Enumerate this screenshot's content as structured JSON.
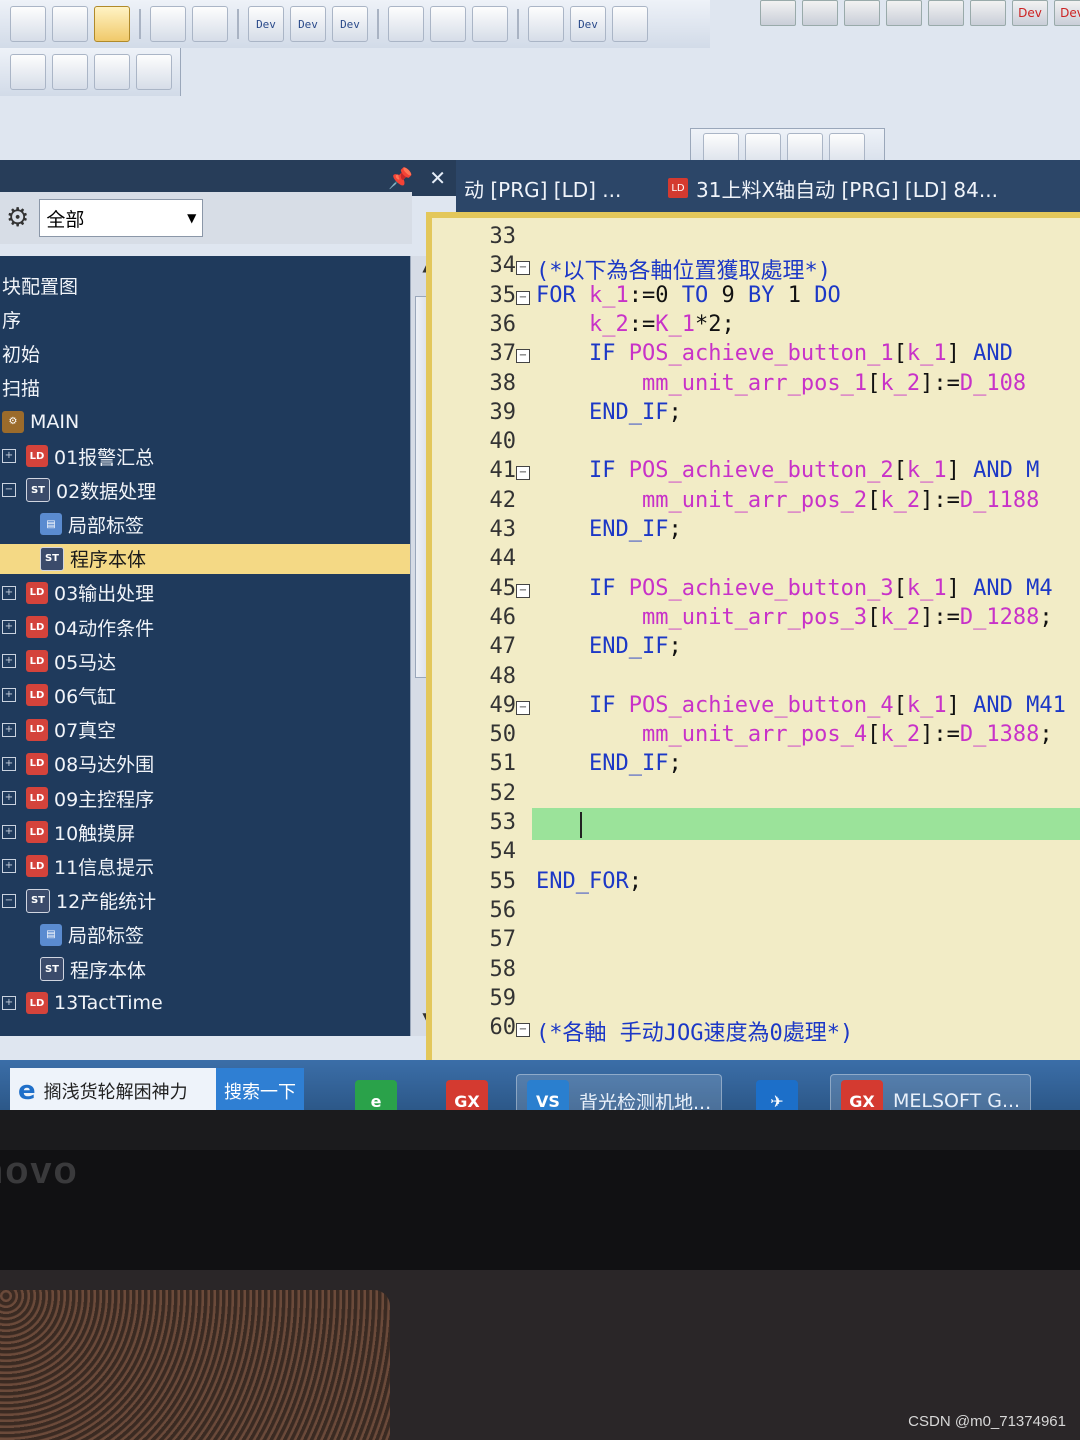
{
  "toolbar": {
    "row1_buttons": [
      "",
      "",
      "",
      "",
      "",
      "Dev",
      "Dev",
      "Dev",
      "",
      "",
      "",
      "",
      "Dev",
      ""
    ],
    "row2_buttons": [
      "",
      "",
      "",
      ""
    ],
    "mini_buttons": [
      "",
      "",
      "",
      ""
    ],
    "top_right": [
      "",
      "",
      "",
      "",
      "",
      "",
      "Dev",
      "Dev"
    ]
  },
  "left_panel": {
    "header_pin": "📌",
    "header_close": "✕",
    "filter_value": "全部",
    "items": [
      {
        "label": "块配置图",
        "icon": "",
        "indent": 0,
        "exp": ""
      },
      {
        "label": "序",
        "icon": "",
        "indent": 0,
        "exp": ""
      },
      {
        "label": "初始",
        "icon": "",
        "indent": 0,
        "exp": ""
      },
      {
        "label": "扫描",
        "icon": "",
        "indent": 0,
        "exp": ""
      },
      {
        "label": "MAIN",
        "icon": "pu",
        "indent": 0,
        "exp": ""
      },
      {
        "label": "01报警汇总",
        "icon": "ld",
        "indent": 1,
        "exp": "+"
      },
      {
        "label": "02数据处理",
        "icon": "st",
        "indent": 1,
        "exp": "−"
      },
      {
        "label": "局部标签",
        "icon": "lbl",
        "indent": 2,
        "exp": ""
      },
      {
        "label": "程序本体",
        "icon": "st",
        "indent": 2,
        "exp": "",
        "selected": true
      },
      {
        "label": "03输出处理",
        "icon": "ld",
        "indent": 1,
        "exp": "+"
      },
      {
        "label": "04动作条件",
        "icon": "ld",
        "indent": 1,
        "exp": "+"
      },
      {
        "label": "05马达",
        "icon": "ld",
        "indent": 1,
        "exp": "+"
      },
      {
        "label": "06气缸",
        "icon": "ld",
        "indent": 1,
        "exp": "+"
      },
      {
        "label": "07真空",
        "icon": "ld",
        "indent": 1,
        "exp": "+"
      },
      {
        "label": "08马达外围",
        "icon": "ld",
        "indent": 1,
        "exp": "+"
      },
      {
        "label": "09主控程序",
        "icon": "ld",
        "indent": 1,
        "exp": "+"
      },
      {
        "label": "10触摸屏",
        "icon": "ld",
        "indent": 1,
        "exp": "+"
      },
      {
        "label": "11信息提示",
        "icon": "ld",
        "indent": 1,
        "exp": "+"
      },
      {
        "label": "12产能统计",
        "icon": "st",
        "indent": 1,
        "exp": "−"
      },
      {
        "label": "局部标签",
        "icon": "lbl",
        "indent": 2,
        "exp": ""
      },
      {
        "label": "程序本体",
        "icon": "st",
        "indent": 2,
        "exp": ""
      },
      {
        "label": "13TactTime",
        "icon": "ld",
        "indent": 1,
        "exp": "+"
      }
    ]
  },
  "tabs": [
    {
      "label": "动 [PRG] [LD] ...",
      "active": false
    },
    {
      "label": "31上料X轴自动 [PRG] [LD] 84...",
      "active": true
    }
  ],
  "editor": {
    "lines": [
      {
        "no": "33",
        "parts": []
      },
      {
        "no": "34",
        "fold": "−",
        "parts": [
          {
            "c": "cm",
            "t": "(*以下為各軸位置獲取處理*)"
          }
        ]
      },
      {
        "no": "35",
        "fold": "−",
        "parts": [
          {
            "c": "kw",
            "t": "FOR "
          },
          {
            "c": "var",
            "t": "k_1"
          },
          {
            "c": "nm",
            "t": ":=0 "
          },
          {
            "c": "kw",
            "t": "TO"
          },
          {
            "c": "nm",
            "t": " 9 "
          },
          {
            "c": "kw",
            "t": "BY"
          },
          {
            "c": "nm",
            "t": " 1 "
          },
          {
            "c": "kw",
            "t": "DO"
          }
        ]
      },
      {
        "no": "36",
        "parts": [
          {
            "c": "nm",
            "t": "    "
          },
          {
            "c": "var",
            "t": "k_2"
          },
          {
            "c": "nm",
            "t": ":="
          },
          {
            "c": "var",
            "t": "K_1"
          },
          {
            "c": "nm",
            "t": "*2;"
          }
        ]
      },
      {
        "no": "37",
        "fold": "−",
        "parts": [
          {
            "c": "nm",
            "t": "    "
          },
          {
            "c": "kw",
            "t": "IF "
          },
          {
            "c": "var",
            "t": "POS_achieve_button_1"
          },
          {
            "c": "nm",
            "t": "["
          },
          {
            "c": "var",
            "t": "k_1"
          },
          {
            "c": "nm",
            "t": "] "
          },
          {
            "c": "kw",
            "t": "AND"
          }
        ]
      },
      {
        "no": "38",
        "parts": [
          {
            "c": "nm",
            "t": "        "
          },
          {
            "c": "var",
            "t": "mm_unit_arr_pos_1"
          },
          {
            "c": "nm",
            "t": "["
          },
          {
            "c": "var",
            "t": "k_2"
          },
          {
            "c": "nm",
            "t": "]:="
          },
          {
            "c": "var",
            "t": "D_108"
          }
        ]
      },
      {
        "no": "39",
        "parts": [
          {
            "c": "nm",
            "t": "    "
          },
          {
            "c": "kw",
            "t": "END_IF"
          },
          {
            "c": "nm",
            "t": ";"
          }
        ]
      },
      {
        "no": "40",
        "parts": []
      },
      {
        "no": "41",
        "fold": "−",
        "parts": [
          {
            "c": "nm",
            "t": "    "
          },
          {
            "c": "kw",
            "t": "IF "
          },
          {
            "c": "var",
            "t": "POS_achieve_button_2"
          },
          {
            "c": "nm",
            "t": "["
          },
          {
            "c": "var",
            "t": "k_1"
          },
          {
            "c": "nm",
            "t": "] "
          },
          {
            "c": "kw",
            "t": "AND M"
          }
        ]
      },
      {
        "no": "42",
        "parts": [
          {
            "c": "nm",
            "t": "        "
          },
          {
            "c": "var",
            "t": "mm_unit_arr_pos_2"
          },
          {
            "c": "nm",
            "t": "["
          },
          {
            "c": "var",
            "t": "k_2"
          },
          {
            "c": "nm",
            "t": "]:="
          },
          {
            "c": "var",
            "t": "D_1188"
          }
        ]
      },
      {
        "no": "43",
        "parts": [
          {
            "c": "nm",
            "t": "    "
          },
          {
            "c": "kw",
            "t": "END_IF"
          },
          {
            "c": "nm",
            "t": ";"
          }
        ]
      },
      {
        "no": "44",
        "parts": []
      },
      {
        "no": "45",
        "fold": "−",
        "parts": [
          {
            "c": "nm",
            "t": "    "
          },
          {
            "c": "kw",
            "t": "IF "
          },
          {
            "c": "var",
            "t": "POS_achieve_button_3"
          },
          {
            "c": "nm",
            "t": "["
          },
          {
            "c": "var",
            "t": "k_1"
          },
          {
            "c": "nm",
            "t": "] "
          },
          {
            "c": "kw",
            "t": "AND M4"
          }
        ]
      },
      {
        "no": "46",
        "parts": [
          {
            "c": "nm",
            "t": "        "
          },
          {
            "c": "var",
            "t": "mm_unit_arr_pos_3"
          },
          {
            "c": "nm",
            "t": "["
          },
          {
            "c": "var",
            "t": "k_2"
          },
          {
            "c": "nm",
            "t": "]:="
          },
          {
            "c": "var",
            "t": "D_1288"
          },
          {
            "c": "nm",
            "t": ";"
          }
        ]
      },
      {
        "no": "47",
        "parts": [
          {
            "c": "nm",
            "t": "    "
          },
          {
            "c": "kw",
            "t": "END_IF"
          },
          {
            "c": "nm",
            "t": ";"
          }
        ]
      },
      {
        "no": "48",
        "parts": []
      },
      {
        "no": "49",
        "fold": "−",
        "parts": [
          {
            "c": "nm",
            "t": "    "
          },
          {
            "c": "kw",
            "t": "IF "
          },
          {
            "c": "var",
            "t": "POS_achieve_button_4"
          },
          {
            "c": "nm",
            "t": "["
          },
          {
            "c": "var",
            "t": "k_1"
          },
          {
            "c": "nm",
            "t": "] "
          },
          {
            "c": "kw",
            "t": "AND M41"
          }
        ]
      },
      {
        "no": "50",
        "parts": [
          {
            "c": "nm",
            "t": "        "
          },
          {
            "c": "var",
            "t": "mm_unit_arr_pos_4"
          },
          {
            "c": "nm",
            "t": "["
          },
          {
            "c": "var",
            "t": "k_2"
          },
          {
            "c": "nm",
            "t": "]:="
          },
          {
            "c": "var",
            "t": "D_1388"
          },
          {
            "c": "nm",
            "t": ";"
          }
        ]
      },
      {
        "no": "51",
        "parts": [
          {
            "c": "nm",
            "t": "    "
          },
          {
            "c": "kw",
            "t": "END_IF"
          },
          {
            "c": "nm",
            "t": ";"
          }
        ]
      },
      {
        "no": "52",
        "parts": []
      },
      {
        "no": "53",
        "parts": []
      },
      {
        "no": "54",
        "parts": []
      },
      {
        "no": "55",
        "parts": [
          {
            "c": "kw",
            "t": "END_FOR"
          },
          {
            "c": "nm",
            "t": ";"
          }
        ]
      },
      {
        "no": "56",
        "parts": []
      },
      {
        "no": "57",
        "parts": []
      },
      {
        "no": "58",
        "parts": []
      },
      {
        "no": "59",
        "parts": []
      },
      {
        "no": "60",
        "fold": "−",
        "parts": [
          {
            "c": "cm",
            "t": "(*各軸 手动JOG速度為0處理*)"
          }
        ]
      }
    ]
  },
  "taskbar": {
    "search_text": "搁浅货轮解困神力",
    "search_button": "搜索一下",
    "apps": [
      {
        "label": "",
        "icon_text": "e",
        "icon_color": "#2aa24a"
      },
      {
        "label": "",
        "icon_text": "GX",
        "icon_color": "#d43a30"
      },
      {
        "label": "背光检测机地...",
        "icon_text": "VS",
        "icon_color": "#2a7fcf"
      },
      {
        "label": "",
        "icon_text": "✈",
        "icon_color": "#1c6fc9"
      },
      {
        "label": "MELSOFT G...",
        "icon_text": "GX",
        "icon_color": "#d43a30"
      }
    ]
  },
  "device": {
    "brand": "novo",
    "watermark": "CSDN @m0_71374961"
  }
}
